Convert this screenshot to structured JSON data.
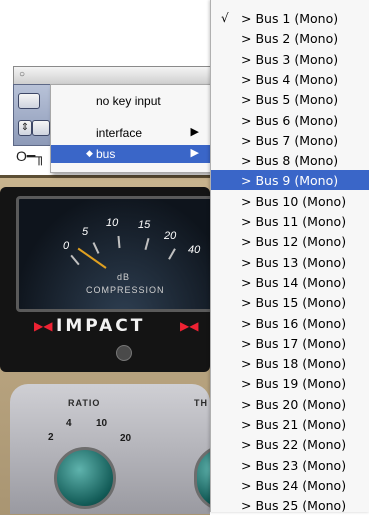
{
  "plugin": {
    "brand_name": "IMPACT",
    "meter": {
      "scale": [
        "0",
        "5",
        "10",
        "15",
        "20",
        "40"
      ],
      "unit_label": "dB",
      "caption": "COMPRESSION"
    },
    "knobs": {
      "ratio_label": "RATIO",
      "ratio_scale": [
        "2",
        "4",
        "10",
        "20"
      ],
      "threshold_label": "TH"
    }
  },
  "key_menu": {
    "items": [
      {
        "label": "no key input"
      },
      {
        "label": "interface"
      },
      {
        "label": "bus"
      }
    ]
  },
  "bus_menu": {
    "checkmark": "√",
    "highlighted_index": 8,
    "items": [
      "> Bus 1 (Mono)",
      "> Bus 2 (Mono)",
      "> Bus 3 (Mono)",
      "> Bus 4 (Mono)",
      "> Bus 5 (Mono)",
      "> Bus 6 (Mono)",
      "> Bus 7 (Mono)",
      "> Bus 8 (Mono)",
      "> Bus 9   (Mono)",
      "> Bus 10 (Mono)",
      "> Bus 11 (Mono)",
      "> Bus 12 (Mono)",
      "> Bus 13 (Mono)",
      "> Bus 14 (Mono)",
      "> Bus 15 (Mono)",
      "> Bus 16 (Mono)",
      "> Bus 17 (Mono)",
      "> Bus 18 (Mono)",
      "> Bus 19 (Mono)",
      "> Bus 20 (Mono)",
      "> Bus 21 (Mono)",
      "> Bus 22 (Mono)",
      "> Bus 23 (Mono)",
      "> Bus 24 (Mono)",
      "> Bus 25 (Mono)"
    ]
  },
  "colors": {
    "menu_highlight": "#3a66c8",
    "knob_teal": "#2f8a84"
  }
}
